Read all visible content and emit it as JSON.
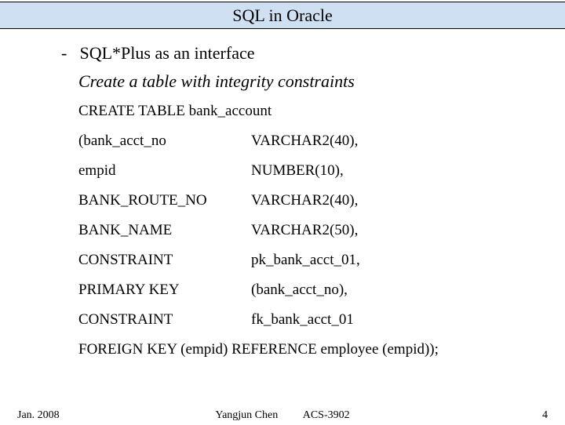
{
  "title": "SQL in Oracle",
  "bullet": "SQL*Plus as an interface",
  "subtitle": "Create a table with integrity constraints",
  "code": {
    "create_line": "CREATE TABLE bank_account",
    "rows": [
      {
        "left": "(bank_acct_no",
        "right": "VARCHAR2(40),"
      },
      {
        "left": "empid",
        "right": "NUMBER(10),"
      },
      {
        "left": "BANK_ROUTE_NO",
        "right": "VARCHAR2(40),"
      },
      {
        "left": "BANK_NAME",
        "right": "VARCHAR2(50),"
      },
      {
        "left": "CONSTRAINT",
        "right": "pk_bank_acct_01,"
      },
      {
        "left": "PRIMARY KEY",
        "right": "(bank_acct_no),"
      },
      {
        "left": "CONSTRAINT",
        "right": "fk_bank_acct_01"
      }
    ],
    "last_line": "FOREIGN KEY (empid) REFERENCE employee (empid));"
  },
  "footer": {
    "date": "Jan. 2008",
    "author": "Yangjun Chen",
    "course": "ACS-3902",
    "page": "4"
  }
}
